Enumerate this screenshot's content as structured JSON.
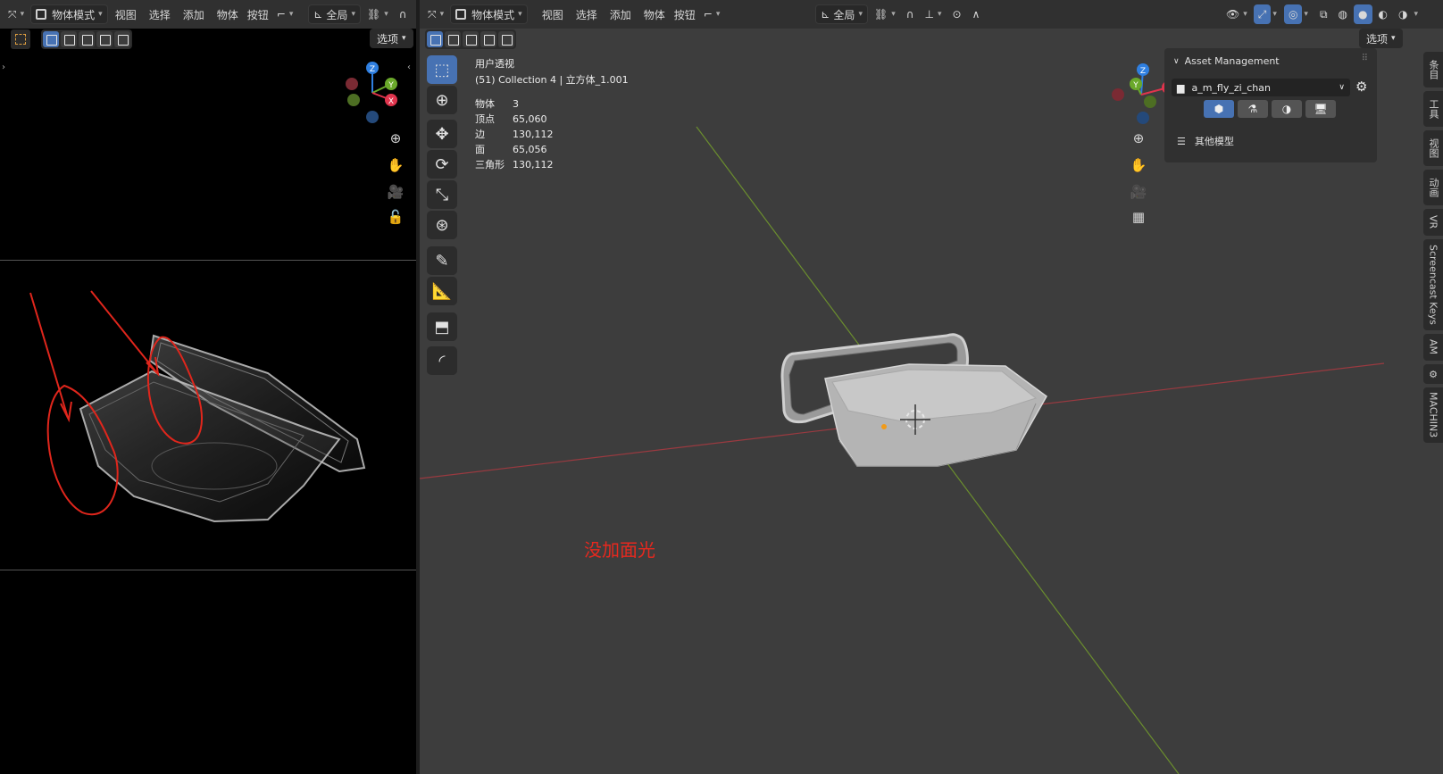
{
  "left_header": {
    "mode_label": "物体模式",
    "menus": [
      "视图",
      "选择",
      "添加",
      "物体",
      "按钮"
    ],
    "transform_label": "全局",
    "options_label": "选项"
  },
  "right_header": {
    "mode_label": "物体模式",
    "menus": [
      "视图",
      "选择",
      "添加",
      "物体",
      "按钮"
    ],
    "transform_label": "全局",
    "options_label": "选项"
  },
  "viewport": {
    "view_name": "用户透视",
    "collection_line": "(51) Collection 4 | 立方体_1.001",
    "stats": [
      {
        "label": "物体",
        "value": "3"
      },
      {
        "label": "顶点",
        "value": "65,060"
      },
      {
        "label": "边",
        "value": "130,112"
      },
      {
        "label": "面",
        "value": "65,056"
      },
      {
        "label": "三角形",
        "value": "130,112"
      }
    ],
    "annotation": "没加面光",
    "annotation_color": "#e8281e",
    "gizmo": {
      "x": "X",
      "y": "Y",
      "z": "Z"
    }
  },
  "asset_panel": {
    "title": "Asset Management",
    "library_name": "a_m_fly_zi_chan",
    "category_label": "其他模型"
  },
  "side_tabs": [
    "条目",
    "工具",
    "视图",
    "动画",
    "VR",
    "Screencast Keys",
    "AM",
    "MACHIN3"
  ],
  "colors": {
    "accent": "#4772b3",
    "x_axis": "#e0344d",
    "y_axis": "#6aa82a",
    "z_axis": "#2f7fe0",
    "viewport_bg": "#3d3d3d"
  }
}
